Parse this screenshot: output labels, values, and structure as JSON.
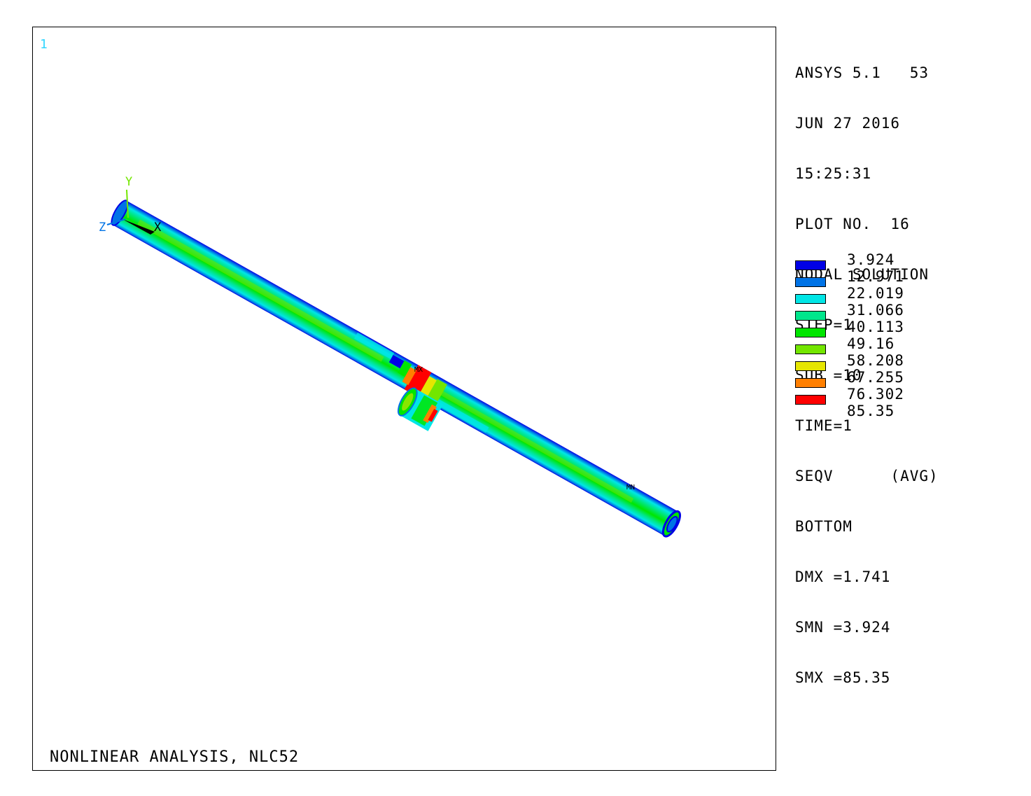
{
  "viewport": {
    "window_number": "1",
    "title": "NONLINEAR ANALYSIS, NLC52",
    "axis_labels": {
      "x": "X",
      "y": "Y",
      "z": "Z"
    },
    "markers": {
      "max": "MX",
      "min": "MN"
    }
  },
  "info": {
    "program": "ANSYS 5.1   53",
    "date": "JUN 27 2016",
    "time": "15:25:31",
    "plot_no": "PLOT NO.  16",
    "solution": "NODAL SOLUTION",
    "step": "STEP=1",
    "sub": "SUB =10",
    "time_value": "TIME=1",
    "result": "SEQV      (AVG)",
    "layer": "BOTTOM",
    "dmx": "DMX =1.741",
    "smn": "SMN =3.924",
    "smx": "SMX =85.35"
  },
  "legend": {
    "labels": [
      "3.924",
      "12.971",
      "22.019",
      "31.066",
      "40.113",
      "49.16",
      "58.208",
      "67.255",
      "76.302",
      "85.35"
    ],
    "colors": [
      "#0000e6",
      "#0073e6",
      "#00e6e6",
      "#00e68c",
      "#00e600",
      "#73e600",
      "#e6e600",
      "#ff7f00",
      "#ff0000"
    ]
  },
  "colors": {
    "background": "#ffffff",
    "window_number": "#33d6ff"
  }
}
